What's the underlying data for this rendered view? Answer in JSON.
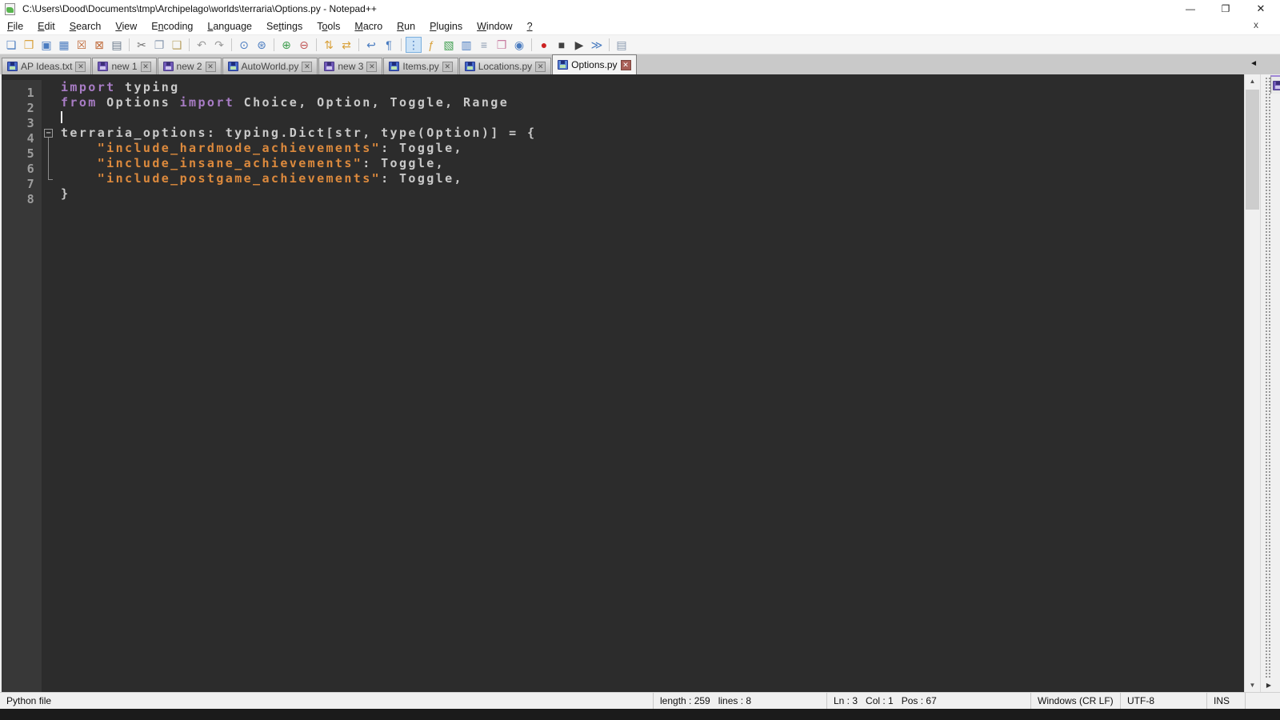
{
  "window": {
    "title": "C:\\Users\\Dood\\Documents\\tmp\\Archipelago\\worlds\\terraria\\Options.py - Notepad++",
    "controls": {
      "minimize": "—",
      "restore": "❐",
      "close": "✕"
    }
  },
  "menu": {
    "close_doc": "x",
    "items": [
      {
        "label": "File",
        "u": 0
      },
      {
        "label": "Edit",
        "u": 0
      },
      {
        "label": "Search",
        "u": 0
      },
      {
        "label": "View",
        "u": 0
      },
      {
        "label": "Encoding",
        "u": 1
      },
      {
        "label": "Language",
        "u": 0
      },
      {
        "label": "Settings",
        "u": 2
      },
      {
        "label": "Tools",
        "u": 1
      },
      {
        "label": "Macro",
        "u": 0
      },
      {
        "label": "Run",
        "u": 0
      },
      {
        "label": "Plugins",
        "u": 0
      },
      {
        "label": "Window",
        "u": 0
      },
      {
        "label": "?",
        "u": 0
      }
    ]
  },
  "toolbar": {
    "groups": [
      [
        {
          "name": "new-file",
          "glyph": "❏",
          "color": "#4a7cc0"
        },
        {
          "name": "open-file",
          "glyph": "❒",
          "color": "#d9a23c"
        },
        {
          "name": "save",
          "glyph": "▣",
          "color": "#4a7cc0"
        },
        {
          "name": "save-all",
          "glyph": "▦",
          "color": "#4a7cc0"
        },
        {
          "name": "close-file",
          "glyph": "☒",
          "color": "#c06a3a"
        },
        {
          "name": "close-all",
          "glyph": "⊠",
          "color": "#c06a3a"
        },
        {
          "name": "print",
          "glyph": "▤",
          "color": "#6a7a8a"
        }
      ],
      [
        {
          "name": "cut",
          "glyph": "✂",
          "color": "#707070"
        },
        {
          "name": "copy",
          "glyph": "❐",
          "color": "#8a9ab0"
        },
        {
          "name": "paste",
          "glyph": "❑",
          "color": "#b8a060"
        }
      ],
      [
        {
          "name": "undo",
          "glyph": "↶",
          "color": "#9a9a9a"
        },
        {
          "name": "redo",
          "glyph": "↷",
          "color": "#9a9a9a"
        }
      ],
      [
        {
          "name": "find",
          "glyph": "⊙",
          "color": "#4a7cc0"
        },
        {
          "name": "replace",
          "glyph": "⊛",
          "color": "#4a7cc0"
        }
      ],
      [
        {
          "name": "zoom-in",
          "glyph": "⊕",
          "color": "#3f9e4f"
        },
        {
          "name": "zoom-out",
          "glyph": "⊖",
          "color": "#c05555"
        }
      ],
      [
        {
          "name": "sync-vertical",
          "glyph": "⇅",
          "color": "#d9a23c"
        },
        {
          "name": "sync-horizontal",
          "glyph": "⇄",
          "color": "#d9a23c"
        }
      ],
      [
        {
          "name": "word-wrap",
          "glyph": "↩",
          "color": "#4a7cc0"
        },
        {
          "name": "show-all-characters",
          "glyph": "¶",
          "color": "#4a7cc0"
        }
      ],
      [
        {
          "name": "show-indent-guide",
          "glyph": "⋮",
          "color": "#4a7cc0",
          "pressed": true
        },
        {
          "name": "function-list",
          "glyph": "ƒ",
          "color": "#d9a23c"
        },
        {
          "name": "folder-as-workspace",
          "glyph": "▧",
          "color": "#3f9e4f"
        },
        {
          "name": "document-map",
          "glyph": "▥",
          "color": "#4a7cc0"
        },
        {
          "name": "document-list",
          "glyph": "≡",
          "color": "#8a9ab0"
        },
        {
          "name": "project-panel",
          "glyph": "❒",
          "color": "#c87ba0"
        },
        {
          "name": "monitoring",
          "glyph": "◉",
          "color": "#4a7cc0"
        }
      ],
      [
        {
          "name": "macro-record",
          "glyph": "●",
          "color": "#cc2222"
        },
        {
          "name": "macro-stop",
          "glyph": "■",
          "color": "#404040"
        },
        {
          "name": "macro-play",
          "glyph": "▶",
          "color": "#404040"
        },
        {
          "name": "macro-run-multiple",
          "glyph": "≫",
          "color": "#4a7cc0"
        }
      ],
      [
        {
          "name": "save-recorded-macro",
          "glyph": "▤",
          "color": "#8a9ab0"
        }
      ]
    ]
  },
  "tabs": {
    "close_glyph": "✕",
    "scroll_left_glyph": "◄",
    "items": [
      {
        "label": "AP Ideas.txt",
        "modified": false,
        "active": false
      },
      {
        "label": "new 1",
        "modified": true,
        "active": false
      },
      {
        "label": "new 2",
        "modified": true,
        "active": false
      },
      {
        "label": "AutoWorld.py",
        "modified": false,
        "active": false
      },
      {
        "label": "new 3",
        "modified": true,
        "active": false
      },
      {
        "label": "Items.py",
        "modified": false,
        "active": false
      },
      {
        "label": "Locations.py",
        "modified": false,
        "active": false
      },
      {
        "label": "Options.py",
        "modified": false,
        "active": true
      }
    ]
  },
  "editor": {
    "language": "Python",
    "colors": {
      "background": "#2c2c2c",
      "gutter_background": "#383838",
      "line_number": "#9d9d9d",
      "keyword": "#a87cc5",
      "string": "#dd8a3d",
      "default_text": "#c9c9c9"
    },
    "line_numbers": [
      "1",
      "2",
      "3",
      "4",
      "5",
      "6",
      "7",
      "8"
    ],
    "lines": [
      {
        "fold": "none",
        "tokens": [
          {
            "c": "kw",
            "t": "import"
          },
          {
            "c": "def",
            "t": " typing"
          }
        ]
      },
      {
        "fold": "none",
        "tokens": [
          {
            "c": "kw",
            "t": "from"
          },
          {
            "c": "def",
            "t": " Options "
          },
          {
            "c": "kw",
            "t": "import"
          },
          {
            "c": "def",
            "t": " Choice, Option, Toggle, Range"
          }
        ]
      },
      {
        "fold": "none",
        "caret": true,
        "tokens": []
      },
      {
        "fold": "box",
        "tokens": [
          {
            "c": "def",
            "t": "terraria_options: typing.Dict[str, type(Option)] = {"
          }
        ]
      },
      {
        "fold": "line",
        "tokens": [
          {
            "c": "def",
            "t": "    "
          },
          {
            "c": "str",
            "t": "\"include_hardmode_achievements\""
          },
          {
            "c": "def",
            "t": ": Toggle,"
          }
        ]
      },
      {
        "fold": "line",
        "tokens": [
          {
            "c": "def",
            "t": "    "
          },
          {
            "c": "str",
            "t": "\"include_insane_achievements\""
          },
          {
            "c": "def",
            "t": ": Toggle,"
          }
        ]
      },
      {
        "fold": "end",
        "tokens": [
          {
            "c": "def",
            "t": "    "
          },
          {
            "c": "str",
            "t": "\"include_postgame_achievements\""
          },
          {
            "c": "def",
            "t": ": Toggle,"
          }
        ]
      },
      {
        "fold": "none",
        "tokens": [
          {
            "c": "def",
            "t": "}"
          }
        ]
      }
    ]
  },
  "scrollbar": {
    "up_glyph": "▲",
    "down_glyph": "▼",
    "right_glyph": "▶"
  },
  "status_bar": {
    "doc_type": "Python file",
    "length_lines": "length : 259   lines : 8",
    "position": "Ln : 3   Col : 1   Pos : 67",
    "eol": "Windows (CR LF)",
    "encoding": "UTF-8",
    "mode": "INS"
  }
}
